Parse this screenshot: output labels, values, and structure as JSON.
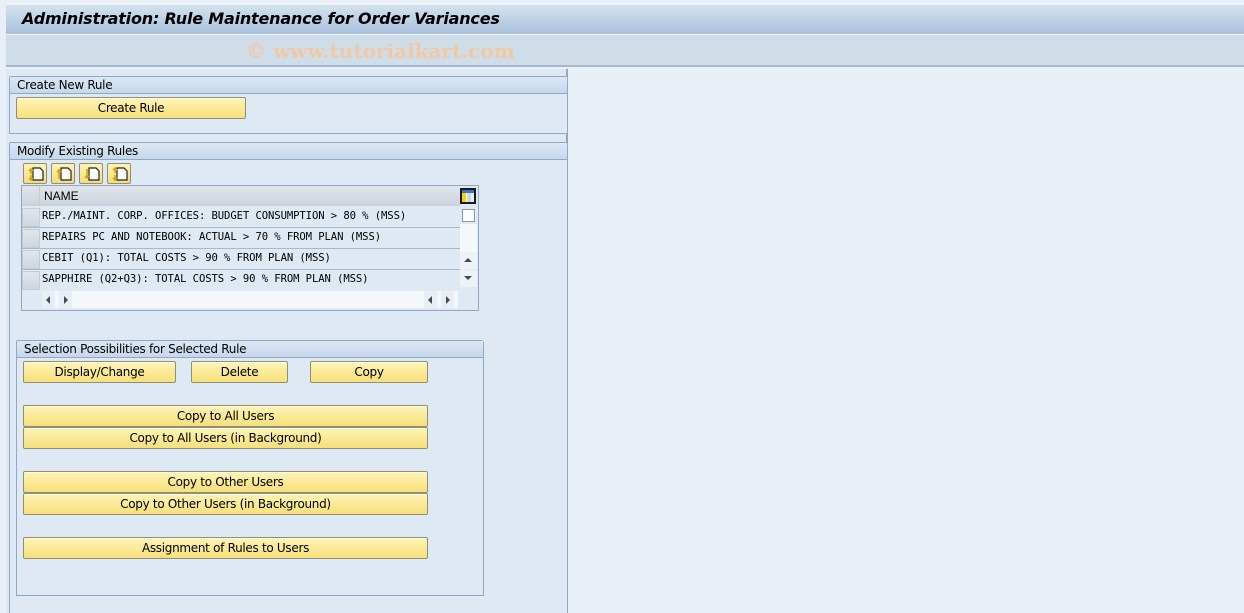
{
  "window": {
    "title": "Administration: Rule Maintenance for Order Variances",
    "watermark": "© www.tutorialkart.com"
  },
  "create_group": {
    "title": "Create New Rule",
    "create_button": "Create Rule"
  },
  "modify_group": {
    "title": "Modify Existing Rules",
    "toolbar_icons": [
      "sort-ascending-icon",
      "sort-up-icon",
      "sort-down-icon",
      "sort-descending-icon"
    ],
    "table": {
      "column_header": "NAME",
      "rows": [
        "REP./MAINT. CORP. OFFICES: BUDGET CONSUMPTION > 80 % (MSS)",
        "REPAIRS PC AND NOTEBOOK: ACTUAL > 70 % FROM PLAN (MSS)",
        "CEBIT (Q1): TOTAL COSTS > 90 % FROM PLAN (MSS)",
        "SAPPHIRE (Q2+Q3): TOTAL COSTS > 90 % FROM PLAN (MSS)"
      ]
    }
  },
  "selection_group": {
    "title": "Selection Possibilities for Selected Rule",
    "buttons": {
      "display_change": "Display/Change",
      "delete": "Delete",
      "copy": "Copy",
      "copy_all_users": "Copy to All Users",
      "copy_all_users_bg": "Copy to All Users (in Background)",
      "copy_other_users": "Copy to Other Users",
      "copy_other_users_bg": "Copy to Other Users (in Background)",
      "assignment": "Assignment of Rules to Users"
    }
  },
  "colors": {
    "button_yellow": "#f7e07a",
    "panel_bg": "#dfe9f4",
    "border": "#8fa8c6"
  }
}
